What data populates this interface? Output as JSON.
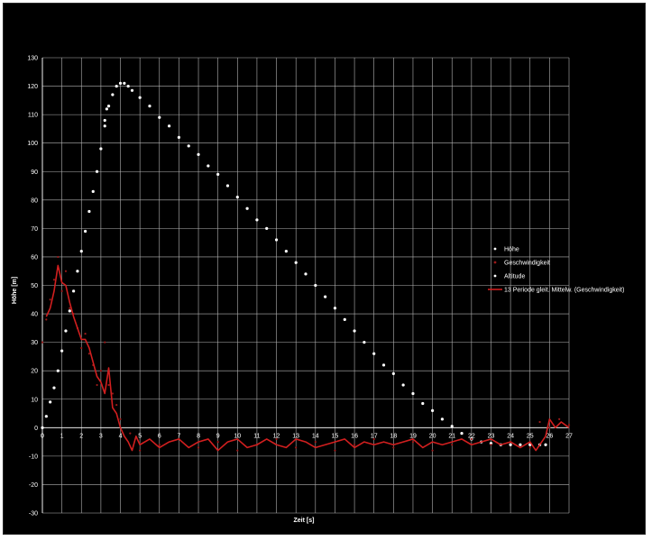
{
  "chart_data": {
    "type": "scatter",
    "xlabel": "Zeit [s]",
    "ylabel": "Höhe [m]",
    "xlim": [
      0,
      27
    ],
    "ylim": [
      -30,
      130
    ],
    "xticks": [
      "0",
      "1",
      "2",
      "3",
      "4",
      "5",
      "6",
      "7",
      "8",
      "9",
      "10",
      "11",
      "12",
      "13",
      "14",
      "15",
      "16",
      "17",
      "18",
      "19",
      "20",
      "21",
      "22",
      "23",
      "24",
      "25",
      "26",
      "27"
    ],
    "yticks": [
      "-30",
      "-20",
      "-10",
      "0",
      "10",
      "20",
      "30",
      "40",
      "50",
      "60",
      "70",
      "80",
      "90",
      "100",
      "110",
      "120",
      "130"
    ],
    "grid": true,
    "legend_position": "right",
    "background": "#000000",
    "series": [
      {
        "name": "Höhe",
        "marker": "dot",
        "color": "#ffffff",
        "x": [
          0,
          0.2,
          0.4,
          0.6,
          0.8,
          1.0,
          1.2,
          1.4,
          1.6,
          1.8,
          2.0,
          2.2,
          2.4,
          2.6,
          2.8,
          3.0,
          3.2,
          3.4,
          3.6,
          3.8,
          4.0,
          4.2,
          4.4,
          4.6,
          5.0,
          5.5,
          6.0,
          6.5,
          7.0,
          7.5,
          8.0,
          8.5,
          9.0,
          9.5,
          10.0,
          10.5,
          11.0,
          11.5,
          12.0,
          12.5,
          13.0,
          13.5,
          14.0,
          14.5,
          15.0,
          15.5,
          16.0,
          16.5,
          17.0,
          17.5,
          18.0,
          18.5,
          19.0,
          19.5,
          20.0,
          20.5,
          21.0,
          21.5,
          22.0,
          22.5,
          23.0,
          23.5,
          24.0,
          24.5,
          25.0,
          25.5,
          25.8
        ],
        "y": [
          0,
          4,
          9,
          14,
          20,
          27,
          34,
          41,
          48,
          55,
          62,
          69,
          76,
          83,
          90,
          98,
          106,
          113,
          117,
          120,
          121,
          121,
          120,
          118.5,
          116,
          113,
          109,
          106,
          102,
          99,
          96,
          92,
          89,
          85,
          81,
          77,
          73,
          70,
          66,
          62,
          58,
          54,
          50,
          46,
          42,
          38,
          34,
          30,
          26,
          22,
          19,
          15,
          12,
          8.5,
          6,
          3,
          0.5,
          -2,
          -4,
          -5,
          -5.5,
          -6,
          -6,
          -6,
          -6,
          -6,
          -6
        ]
      },
      {
        "name": "Geschwindigkeit",
        "marker": "dot",
        "color": "#9b1a1a",
        "x": [
          0,
          0.2,
          0.4,
          0.6,
          0.8,
          1.0,
          1.2,
          1.4,
          1.6,
          1.8,
          2.0,
          2.2,
          2.4,
          2.6,
          2.8,
          3.0,
          3.2,
          3.4,
          3.6,
          3.8,
          4.0,
          4.5,
          5.0,
          6.0,
          7.0,
          8.0,
          9.0,
          10.0,
          11.0,
          12.0,
          13.0,
          14.0,
          15.0,
          16.0,
          17.0,
          18.0,
          19.0,
          20.0,
          21.0,
          22.0,
          23.0,
          24.0,
          25.0,
          25.5,
          26.0,
          26.5,
          27.0
        ],
        "y": [
          30,
          38,
          45,
          52,
          60,
          48,
          55,
          42,
          40,
          35,
          28,
          33,
          26,
          22,
          15,
          20,
          30,
          15,
          12,
          8,
          3,
          -2,
          -8,
          -6,
          -4,
          -7,
          -5,
          -8,
          -6,
          -4,
          -7,
          -5,
          -8,
          -6,
          -4,
          -7,
          -5,
          -8,
          -6,
          -4,
          -6,
          -5,
          -7,
          2,
          0,
          3,
          1
        ]
      },
      {
        "name": "Altitude",
        "marker": "dot",
        "color": "#ffffff",
        "x": [
          3.2,
          3.3
        ],
        "y": [
          108,
          112
        ]
      },
      {
        "name": "13 Periode gleit. Mittelw. (Geschwindigkeit)",
        "marker": "line",
        "color": "#d11f1f",
        "x": [
          0.2,
          0.4,
          0.6,
          0.8,
          1.0,
          1.2,
          1.4,
          1.6,
          1.8,
          2.0,
          2.2,
          2.4,
          2.6,
          2.8,
          3.0,
          3.2,
          3.4,
          3.6,
          3.8,
          4.0,
          4.2,
          4.4,
          4.6,
          4.8,
          5.0,
          5.5,
          6.0,
          6.5,
          7.0,
          7.5,
          8.0,
          8.5,
          9.0,
          9.5,
          10.0,
          10.5,
          11.0,
          11.5,
          12.0,
          12.5,
          13.0,
          13.5,
          14.0,
          14.5,
          15.0,
          15.5,
          16.0,
          16.5,
          17.0,
          17.5,
          18.0,
          18.5,
          19.0,
          19.5,
          20.0,
          20.5,
          21.0,
          21.5,
          22.0,
          22.5,
          23.0,
          23.5,
          24.0,
          24.5,
          25.0,
          25.3,
          25.6,
          25.8,
          26.0,
          26.3,
          26.6,
          27.0
        ],
        "y": [
          39,
          42,
          48,
          57,
          51,
          50,
          44,
          39,
          35,
          31,
          31,
          28,
          23,
          18,
          16,
          12,
          21,
          7,
          5,
          0,
          -3,
          -5,
          -8,
          -3,
          -6,
          -4,
          -7,
          -5,
          -4,
          -7,
          -5,
          -4,
          -8,
          -5,
          -4,
          -7,
          -6,
          -4,
          -6,
          -7,
          -4,
          -5,
          -7,
          -6,
          -5,
          -4,
          -7,
          -5,
          -6,
          -5,
          -6,
          -5,
          -4,
          -7,
          -5,
          -6,
          -5,
          -4,
          -6,
          -5,
          -4,
          -6,
          -5,
          -7,
          -5,
          -8,
          -5,
          -3,
          3,
          0,
          2,
          0
        ]
      }
    ]
  }
}
